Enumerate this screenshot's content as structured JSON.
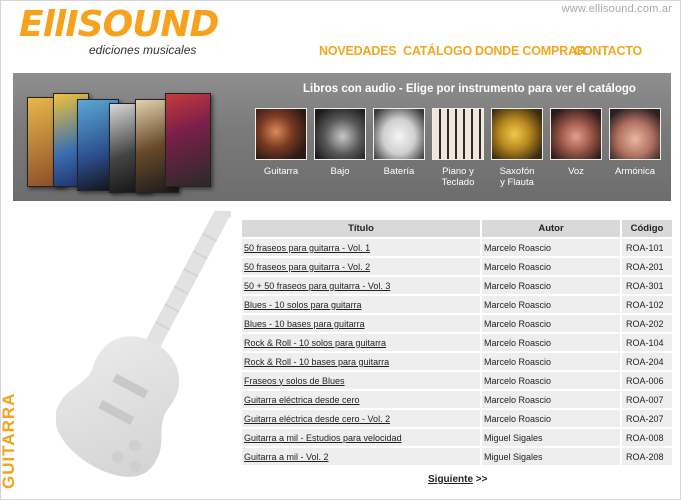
{
  "header": {
    "site_url": "www.ellisound.com.ar",
    "logo_text": "EllISOUND",
    "logo_subtitle": "ediciones musicales",
    "brand_color": "#f6a21c"
  },
  "nav": {
    "items": [
      {
        "label": "NOVEDADES"
      },
      {
        "label": "CATÁLOGO"
      },
      {
        "label": "DONDE COMPRAR"
      },
      {
        "label": "CONTACTO"
      }
    ]
  },
  "banner": {
    "title": "Libros con audio - Elige por instrumento para ver el catálogo",
    "instruments": [
      {
        "label": "Guitarra",
        "icon": "guitar-photo"
      },
      {
        "label": "Bajo",
        "icon": "bass-photo"
      },
      {
        "label": "Batería",
        "icon": "drum-photo"
      },
      {
        "label": "Piano y\nTeclado",
        "icon": "piano-photo"
      },
      {
        "label": "Saxofón\ny Flauta",
        "icon": "saxophone-photo"
      },
      {
        "label": "Voz",
        "icon": "singer-photo"
      },
      {
        "label": "Armónica",
        "icon": "harmonica-photo"
      }
    ]
  },
  "section": {
    "label": "GUITARRA"
  },
  "table": {
    "headers": {
      "title": "Título",
      "author": "Autor",
      "code": "Código"
    },
    "rows": [
      {
        "title": "50 fraseos para guitarra - Vol. 1",
        "author": "Marcelo Roascio",
        "code": "ROA-101"
      },
      {
        "title": "50 fraseos para guitarra - Vol. 2",
        "author": "Marcelo Roascio",
        "code": "ROA-201"
      },
      {
        "title": "50 + 50 fraseos para guitarra - Vol. 3",
        "author": "Marcelo Roascio",
        "code": "ROA-301"
      },
      {
        "title": "Blues - 10 solos para guitarra",
        "author": "Marcelo Roascio",
        "code": "ROA-102"
      },
      {
        "title": "Blues - 10 bases para guitarra",
        "author": "Marcelo Roascio",
        "code": "ROA-202"
      },
      {
        "title": "Rock & Roll - 10 solos para guitarra",
        "author": "Marcelo Roascio",
        "code": "ROA-104"
      },
      {
        "title": "Rock & Roll - 10 bases para guitarra",
        "author": "Marcelo Roascio",
        "code": "ROA-204"
      },
      {
        "title": "Fraseos y solos de Blues",
        "author": "Marcelo Roascio",
        "code": "ROA-006"
      },
      {
        "title": "Guitarra eléctrica desde cero",
        "author": "Marcelo Roascio",
        "code": "ROA-007"
      },
      {
        "title": "Guitarra eléctrica desde cero - Vol. 2",
        "author": "Marcelo Roascio",
        "code": "ROA-207"
      },
      {
        "title": "Guitarra a mil - Estudios para velocidad",
        "author": "Miguel Sigales",
        "code": "ROA-008"
      },
      {
        "title": "Guitarra a mil - Vol. 2",
        "author": "Miguel Sigales",
        "code": "ROA-208"
      }
    ]
  },
  "pagination": {
    "next_label": "Siguiente",
    "next_arrow": ">>"
  }
}
